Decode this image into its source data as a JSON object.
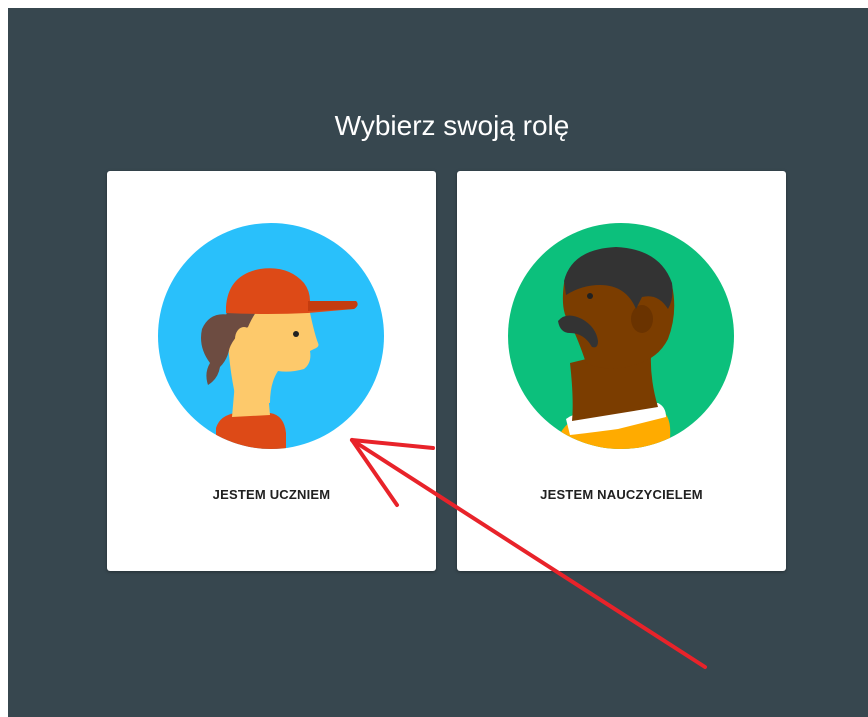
{
  "page": {
    "title": "Wybierz swoją rolę"
  },
  "roles": [
    {
      "label": "JESTEM UCZNIEM",
      "avatar_icon": "student-avatar-icon",
      "avatar_bg": "#29c0fb"
    },
    {
      "label": "JESTEM NAUCZYCIELEM",
      "avatar_icon": "teacher-avatar-icon",
      "avatar_bg": "#0cc07c"
    }
  ],
  "colors": {
    "background": "#37474f",
    "card": "#ffffff",
    "annotation_arrow": "#e8232a"
  }
}
